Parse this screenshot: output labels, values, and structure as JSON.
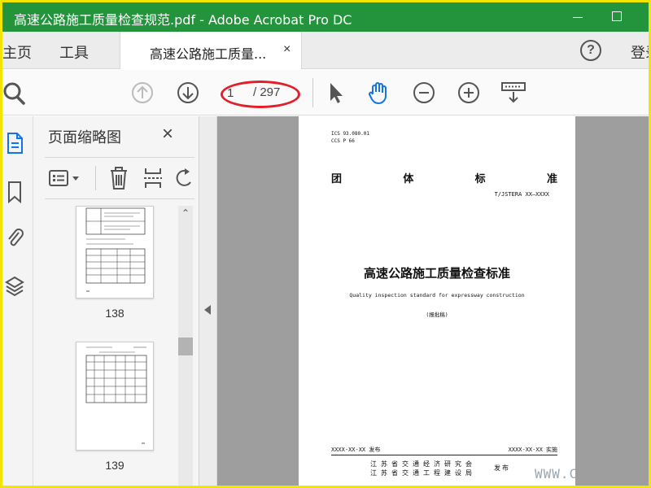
{
  "window": {
    "title": "高速公路施工质量检查规范.pdf - Adobe Acrobat Pro DC",
    "minimize_label": "",
    "maximize_label": ""
  },
  "tabs": {
    "home": "主页",
    "tools": "工具",
    "document": "高速公路施工质量...",
    "close": "×",
    "help": "?",
    "login": "登录"
  },
  "toolbar": {
    "current_page": "1",
    "total_pages": "/ 297",
    "icons": [
      "search-icon",
      "prev-page-icon",
      "next-page-icon",
      "select-arrow-icon",
      "hand-icon",
      "zoom-out-icon",
      "zoom-in-icon",
      "read-mode-icon"
    ]
  },
  "thumbnails": {
    "title": "页面缩略图",
    "close": "×",
    "pages": [
      {
        "number": "138"
      },
      {
        "number": "139"
      }
    ]
  },
  "document": {
    "ics": "ICS 93.080.01",
    "ccs": "CCS P 66",
    "standard_type": [
      "团",
      "体",
      "标",
      "准"
    ],
    "code": "T/JSTERA XX—XXXX",
    "title_cn": "高速公路施工质量检查标准",
    "title_en": "Quality inspection standard for expressway construction",
    "draft": "(报批稿)",
    "publish_date": "XXXX-XX-XX 发布",
    "implement_date": "XXXX-XX-XX 实施",
    "org_line1": "江苏省交通经济研究会",
    "org_line2": "江苏省交通工程建设局",
    "issue": "发布"
  },
  "watermark": "WWW.C",
  "colors": {
    "titlebar": "#23943c",
    "accent": "#1473e6",
    "highlight_ellipse": "#e0202a",
    "frame": "#f2e600"
  }
}
